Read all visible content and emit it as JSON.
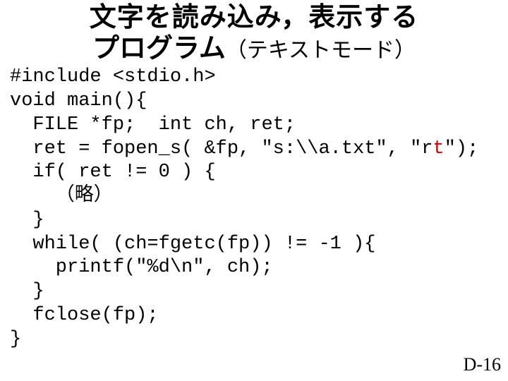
{
  "title": {
    "line1": "文字を読み込み，表示する",
    "line2_main": "プログラム",
    "line2_sub": "（テキストモード）"
  },
  "code": {
    "l1": "#include <stdio.h>",
    "l2": "void main(){",
    "l3": "  FILE *fp;  int ch, ret;",
    "l4a": "  ret = fopen_s( &fp, \"s:\\\\a.txt\", \"r",
    "l4b": "t",
    "l4c": "\");",
    "l5": "  if( ret != 0 ) {",
    "l6": "    （略）",
    "l7": "  }",
    "l8": "  while( (ch=fgetc(fp)) != -1 ){",
    "l9": "    printf(\"%d\\n\", ch);",
    "l10": "  }",
    "l11": "  fclose(fp);",
    "l12": "}"
  },
  "pagenum": "D-16"
}
